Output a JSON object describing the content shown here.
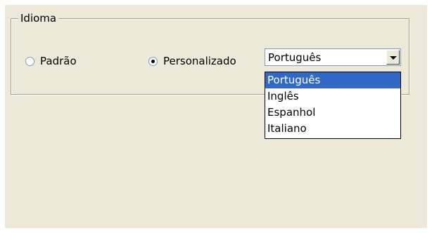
{
  "language_group": {
    "title": "Idioma",
    "options": {
      "default_label": "Padrão",
      "custom_label": "Personalizado"
    },
    "selected_option": "custom"
  },
  "language_select": {
    "value": "Português",
    "items": [
      "Português",
      "Inglês",
      "Espanhol",
      "Italiano"
    ],
    "highlighted_index": 0
  },
  "colors": {
    "highlight": "#316ac5",
    "window_background": "#ece9d8"
  },
  "icons": {
    "dropdown": "chevron-down-icon",
    "radio_default": "radio-unchecked-icon",
    "radio_custom": "radio-checked-icon"
  }
}
